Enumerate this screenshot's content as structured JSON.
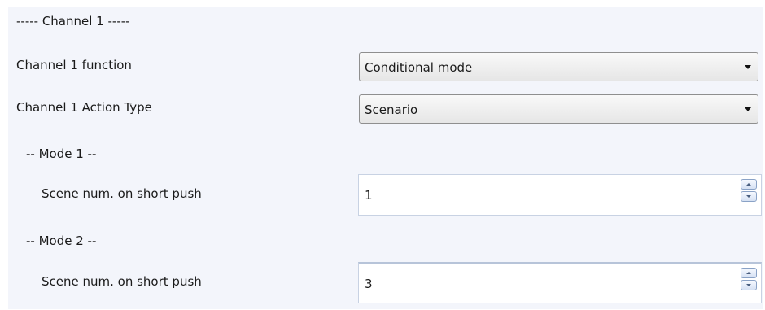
{
  "header": {
    "label": "----- Channel 1 -----"
  },
  "function": {
    "label": "Channel 1 function",
    "value": "Conditional mode"
  },
  "action_type": {
    "label": "Channel 1 Action Type",
    "value": "Scenario"
  },
  "mode1": {
    "header": "-- Mode 1 --",
    "label": "Scene num. on short push",
    "value": "1"
  },
  "mode2": {
    "header": "-- Mode 2 --",
    "label": "Scene num. on short push",
    "value": "3"
  },
  "icons": {
    "dropdown": "chevron-down-icon",
    "spin_up": "spin-up-icon",
    "spin_down": "spin-down-icon"
  }
}
